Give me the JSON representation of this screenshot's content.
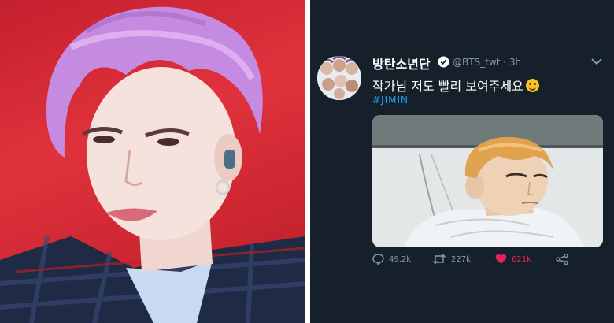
{
  "tweet": {
    "display_name": "방탄소년단",
    "handle_time": "@BTS_twt · 3h",
    "text": "작가님 저도 빨리 보여주세요",
    "hashtag": "#JIMIN",
    "stats": {
      "replies": "49.2k",
      "retweets": "227k",
      "likes": "621k"
    }
  },
  "colors": {
    "background": "#15202b",
    "accent": "#1da1f2",
    "like": "#e0245e",
    "muted": "#8899a6"
  },
  "icons": [
    "verified-icon",
    "chevron-down-icon",
    "reply-icon",
    "retweet-icon",
    "heart-icon",
    "share-icon",
    "smiling-face-emoji-icon"
  ]
}
